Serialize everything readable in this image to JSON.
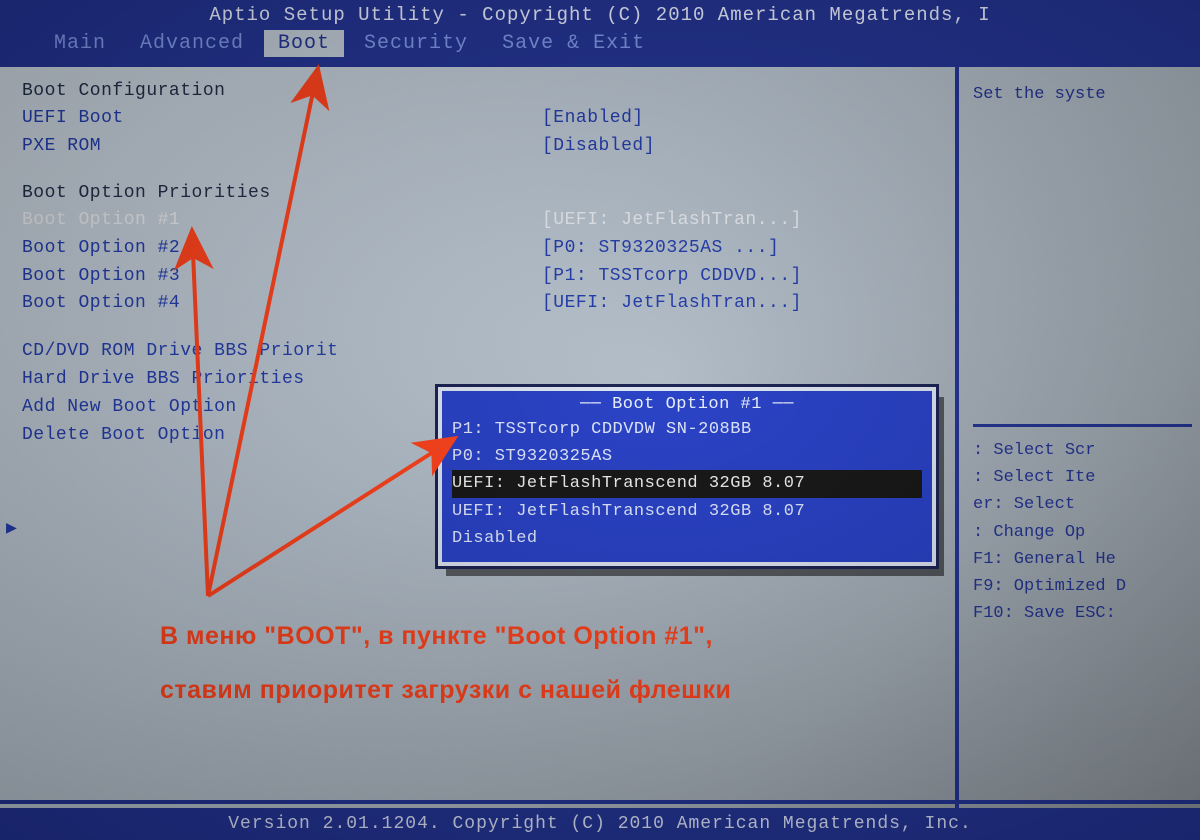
{
  "header": {
    "title": "Aptio Setup Utility - Copyright (C) 2010 American Megatrends, I"
  },
  "menu": {
    "items": [
      "Main",
      "Advanced",
      "Boot",
      "Security",
      "Save & Exit"
    ],
    "active_index": 2
  },
  "main": {
    "section_boot_config": "Boot Configuration",
    "uefi_boot": {
      "label": "UEFI Boot",
      "value": "[Enabled]"
    },
    "pxe_rom": {
      "label": "PXE ROM",
      "value": "[Disabled]"
    },
    "section_priorities": "Boot Option Priorities",
    "boot_options": [
      {
        "label": "Boot Option #1",
        "value": "[UEFI: JetFlashTran...]",
        "selected": true
      },
      {
        "label": "Boot Option #2",
        "value": "[P0: ST9320325AS   ...]",
        "selected": false
      },
      {
        "label": "Boot Option #3",
        "value": "[P1: TSSTcorp CDDVD...]",
        "selected": false
      },
      {
        "label": "Boot Option #4",
        "value": "[UEFI: JetFlashTran...]",
        "selected": false
      }
    ],
    "links": [
      "CD/DVD ROM Drive BBS Priorit",
      "Hard Drive BBS Priorities",
      "Add New Boot Option",
      "Delete Boot Option"
    ]
  },
  "popup": {
    "title": "Boot Option #1",
    "options": [
      "P1: TSSTcorp CDDVDW SN-208BB",
      "P0: ST9320325AS",
      "UEFI: JetFlashTranscend 32GB 8.07",
      "UEFI: JetFlashTranscend 32GB 8.07",
      "Disabled"
    ],
    "selected_index": 2
  },
  "help": {
    "top": "Set the syste",
    "lines": [
      ": Select Scr",
      ": Select Ite",
      "er: Select",
      ": Change Op",
      "F1: General He",
      "F9: Optimized D",
      "F10: Save  ESC:"
    ]
  },
  "footer": {
    "text": "Version 2.01.1204. Copyright (C) 2010 American Megatrends, Inc."
  },
  "annotation": {
    "line1": "В меню \"BOOT\", в пункте \"Boot Option #1\",",
    "line2": "ставим приоритет загрузки с нашей флешки"
  }
}
